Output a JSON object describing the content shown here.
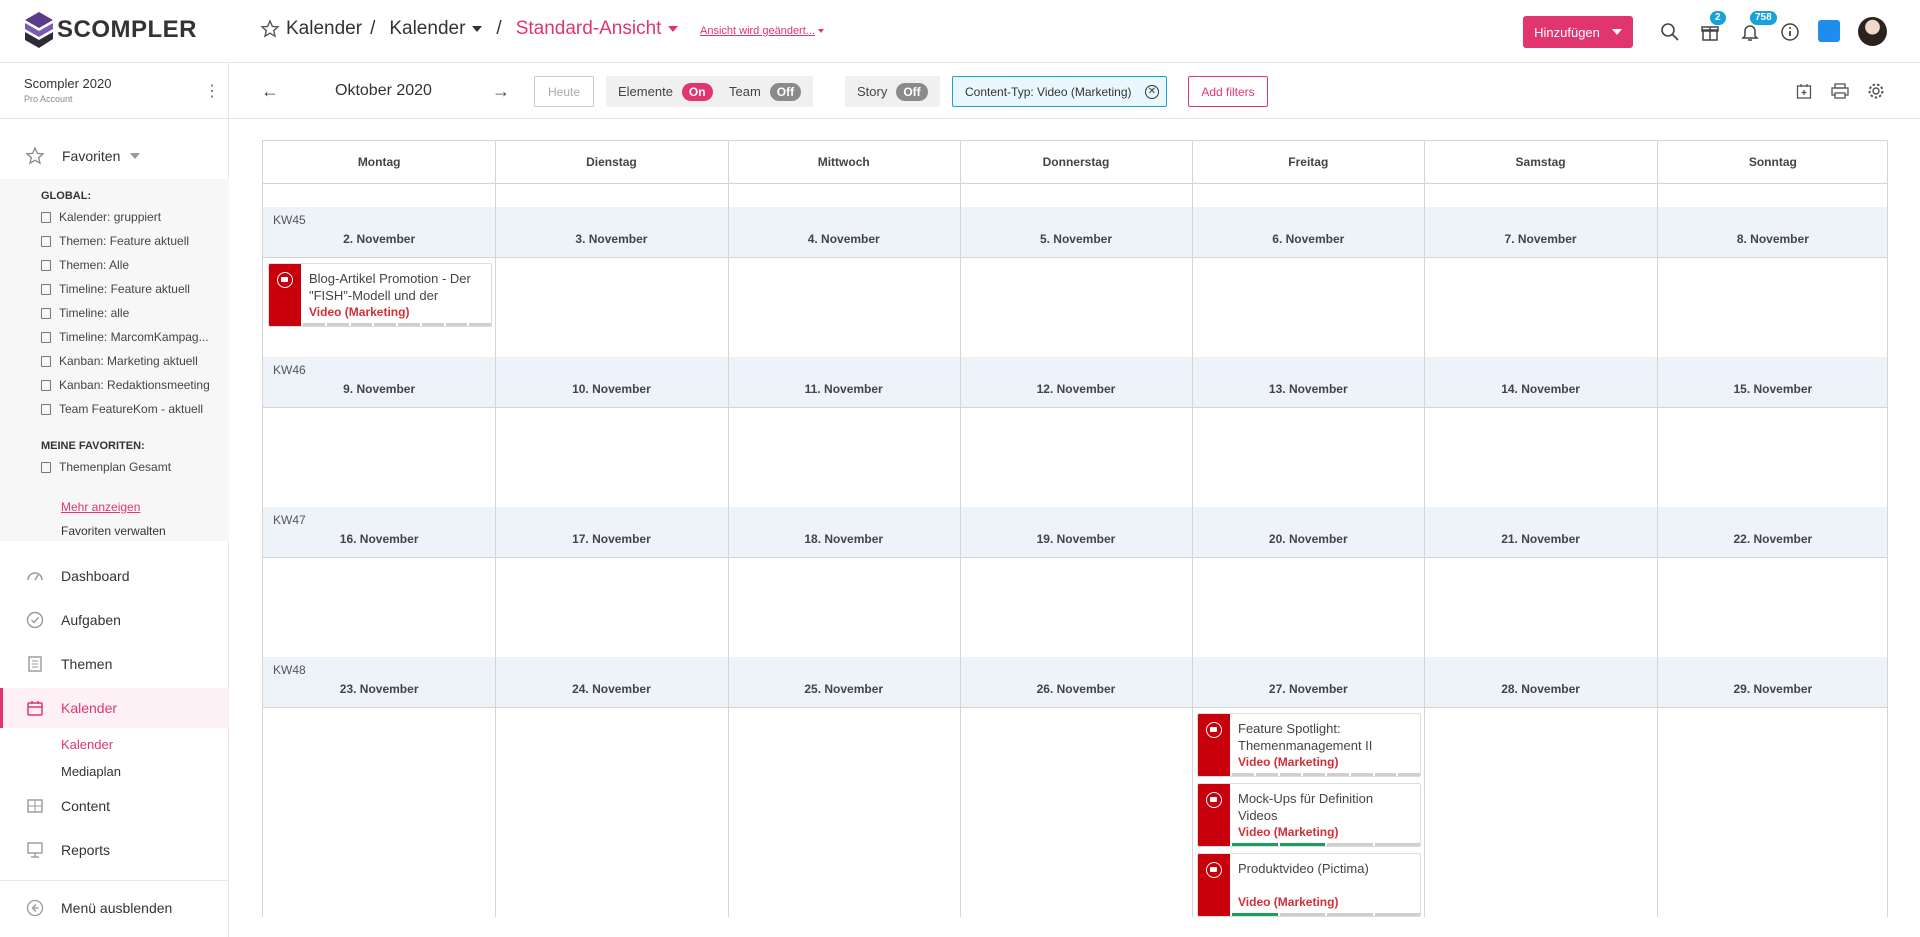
{
  "app": {
    "logo_text": "SCOMPLER",
    "breadcrumb": {
      "first": "Kalender",
      "sep1": "/",
      "second": "Kalender",
      "sep2": "/",
      "third": "Standard-Ansicht"
    },
    "view_changed": "Ansicht wird geändert...",
    "add_button": "Hinzufügen",
    "badges": {
      "gifts": "2",
      "notifications": "758"
    }
  },
  "sidebar": {
    "account_name": "Scompler 2020",
    "account_sub": "Pro Account",
    "favorites_label": "Favoriten",
    "global_label": "GLOBAL:",
    "global_items": [
      "Kalender: gruppiert",
      "Themen: Feature aktuell",
      "Themen: Alle",
      "Timeline: Feature aktuell",
      "Timeline: alle",
      "Timeline: MarcomKampag...",
      "Kanban: Marketing aktuell",
      "Kanban: Redaktionsmeeting",
      "Team FeatureKom - aktuell"
    ],
    "my_favorites_label": "MEINE FAVORITEN:",
    "my_favorites_items": [
      "Themenplan Gesamt"
    ],
    "more_link": "Mehr anzeigen",
    "manage_link": "Favoriten verwalten",
    "nav": {
      "dashboard": "Dashboard",
      "tasks": "Aufgaben",
      "topics": "Themen",
      "calendar": "Kalender",
      "calendar_sub": "Kalender",
      "mediaplan": "Mediaplan",
      "content": "Content",
      "reports": "Reports",
      "hide_menu": "Menü ausblenden"
    }
  },
  "toolbar": {
    "month": "Oktober 2020",
    "today": "Heute",
    "elements_label": "Elemente",
    "elements_state": "On",
    "team_label": "Team",
    "team_state": "Off",
    "story_label": "Story",
    "story_state": "Off",
    "filter_chip": "Content-Typ: Video (Marketing)",
    "add_filters": "Add filters"
  },
  "calendar": {
    "days": [
      "Montag",
      "Dienstag",
      "Mittwoch",
      "Donnerstag",
      "Freitag",
      "Samstag",
      "Sonntag"
    ],
    "weeks": [
      {
        "kw": "KW45",
        "dates": [
          "2. November",
          "3. November",
          "4. November",
          "5. November",
          "6. November",
          "7. November",
          "8. November"
        ]
      },
      {
        "kw": "KW46",
        "dates": [
          "9. November",
          "10. November",
          "11. November",
          "12. November",
          "13. November",
          "14. November",
          "15. November"
        ]
      },
      {
        "kw": "KW47",
        "dates": [
          "16. November",
          "17. November",
          "18. November",
          "19. November",
          "20. November",
          "21. November",
          "22. November"
        ]
      },
      {
        "kw": "KW48",
        "dates": [
          "23. November",
          "24. November",
          "25. November",
          "26. November",
          "27. November",
          "28. November",
          "29. November"
        ]
      }
    ],
    "events": [
      {
        "title": "Blog-Artikel Promotion - Der \"FISH\"-Modell und der",
        "type": "Video (Marketing)",
        "progress_done": 0,
        "progress_total": 8
      },
      {
        "title": "Feature Spotlight: Themenmanagement II",
        "type": "Video (Marketing)",
        "progress_done": 0,
        "progress_total": 8
      },
      {
        "title": "Mock-Ups für Definition Videos",
        "type": "Video (Marketing)",
        "progress_done": 2,
        "progress_total": 4
      },
      {
        "title": "Produktvideo (Pictima)",
        "type": "Video (Marketing)",
        "progress_done": 1,
        "progress_total": 4
      }
    ]
  },
  "colors": {
    "accent": "#e0356f",
    "blue": "#17a2d8",
    "youtube_red": "#c8000c",
    "week_band": "#edf3f9"
  }
}
